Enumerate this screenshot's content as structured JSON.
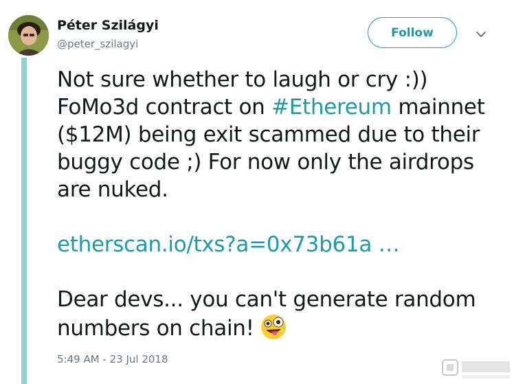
{
  "author": {
    "display_name": "Péter Szilágyi",
    "handle": "@peter_szilagyi",
    "avatar_icon": "user-avatar-photo"
  },
  "follow_button": {
    "label": "Follow"
  },
  "menu": {
    "icon": "chevron-down-icon"
  },
  "tweet": {
    "line_1": "Not sure whether to laugh or cry :))",
    "line_2_pre": "FoMo3d contract on ",
    "hashtag": "#Ethereum",
    "line_2_post": " mainnet",
    "line_3": "($12M) being exit scammed due to their",
    "line_4": "buggy code ;) For now only the airdrops",
    "line_5": "are nuked.",
    "link": "etherscan.io/txs?a=0x73b61a …",
    "line_6": "Dear devs... you can't generate random",
    "line_7": "numbers on chain!",
    "emoji_icon": "zany-face-emoji"
  },
  "timestamp": "5:49 AM - 23 Jul 2018",
  "colors": {
    "accent": "#1c9aa8",
    "thread_line": "#8fd0d3",
    "muted": "#657786",
    "text": "#14171a"
  }
}
